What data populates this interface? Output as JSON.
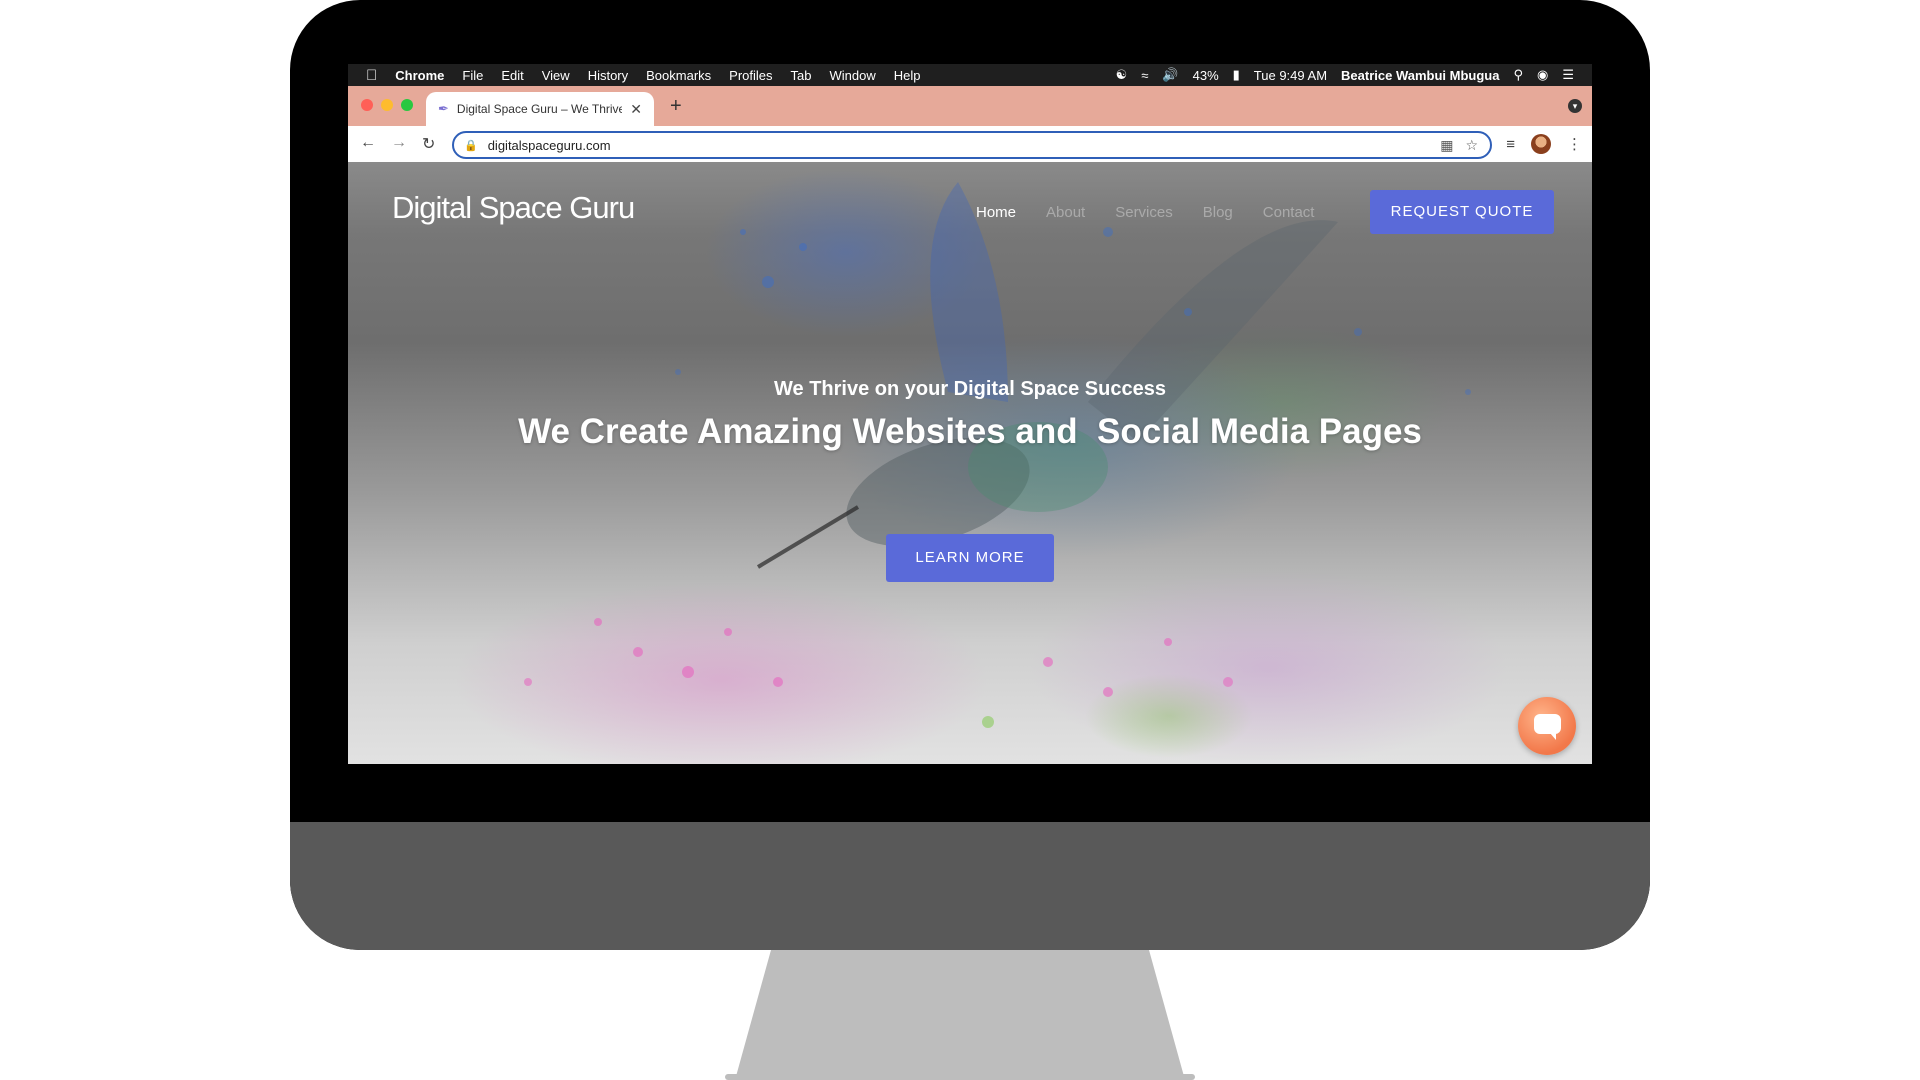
{
  "menubar": {
    "apple_icon": "apple-icon",
    "app_name": "Chrome",
    "menus": [
      "File",
      "Edit",
      "View",
      "History",
      "Bookmarks",
      "Profiles",
      "Tab",
      "Window",
      "Help"
    ],
    "battery": "43%",
    "datetime": "Tue 9:49 AM",
    "user": "Beatrice Wambui Mbugua"
  },
  "browser": {
    "tab_title": "Digital Space Guru – We Thrive",
    "url": "digitalspaceguru.com"
  },
  "site": {
    "logo": "Digital Space Guru",
    "nav": [
      "Home",
      "About",
      "Services",
      "Blog",
      "Contact"
    ],
    "quote_button": "REQUEST QUOTE",
    "eyebrow": "We Thrive on your Digital Space Success",
    "headline": "We Create Amazing Websites and  Social Media Pages",
    "cta_button": "LEARN MORE",
    "accent_color": "#5a6ad9",
    "chat_color": "#f2784a"
  }
}
